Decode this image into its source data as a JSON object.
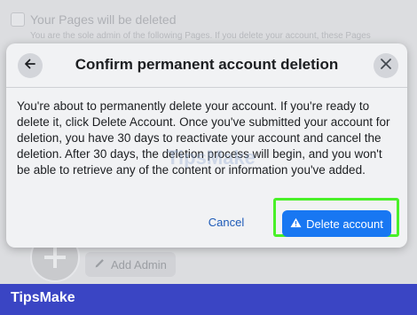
{
  "background": {
    "notice_title": "Your Pages will be deleted",
    "notice_subtitle": "You are the sole admin of the following Pages. If you delete your account, these Pages",
    "add_admin_label": "Add Admin"
  },
  "dialog": {
    "title": "Confirm permanent account deletion",
    "body": "You're about to permanently delete your account. If you're ready to delete it, click Delete Account. Once you've submitted your account for deletion, you have 30 days to reactivate your account and cancel the deletion. After 30 days, the deletion process will begin, and you won't be able to retrieve any of the content or information you've added.",
    "cancel_label": "Cancel",
    "delete_label": "Delete account",
    "back_icon": "arrow-left-icon",
    "close_icon": "close-icon",
    "warning_icon": "warning-triangle-icon"
  },
  "footer": {
    "brand": "TipsMake"
  },
  "watermark": "TipsMake",
  "colors": {
    "primary": "#1877f2",
    "link": "#1e5bb8",
    "highlight": "#49f028",
    "footer": "#3a45c4"
  }
}
